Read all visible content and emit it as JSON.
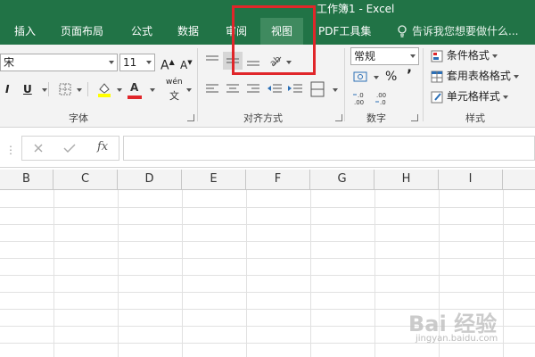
{
  "window": {
    "title": "工作簿1 - Excel"
  },
  "tabs": [
    "插入",
    "页面布局",
    "公式",
    "数据",
    "审阅",
    "视图",
    "PDF工具集"
  ],
  "tell_me": {
    "placeholder": "告诉我您想要做什么..."
  },
  "ribbon": {
    "font": {
      "name_value": "宋",
      "size_value": "11",
      "grow_label": "A",
      "shrink_label": "A",
      "italic_label": "I",
      "underline_label": "U",
      "font_color_label": "A",
      "phonetic_label": "wén",
      "group_label": "字体"
    },
    "alignment": {
      "group_label": "对齐方式"
    },
    "number": {
      "format_value": "常规",
      "percent_label": "%",
      "comma_label": "’",
      "group_label": "数字"
    },
    "styles": {
      "conditional_label": "条件格式",
      "table_label": "套用表格格式",
      "cell_label": "单元格样式",
      "group_label": "样式"
    }
  },
  "formula_bar": {
    "fx_label": "fx"
  },
  "columns": [
    "B",
    "C",
    "D",
    "E",
    "F",
    "G",
    "H",
    "I"
  ],
  "watermark": {
    "text": "Bai 经验",
    "sub": "jingyan.baidu.com"
  },
  "colors": {
    "excel_green": "#217346",
    "active_tab": "#3f8a5f",
    "highlight": "#e0262a",
    "font_color_bar": "#e0262a",
    "fill_color_bar": "#ffff00"
  }
}
